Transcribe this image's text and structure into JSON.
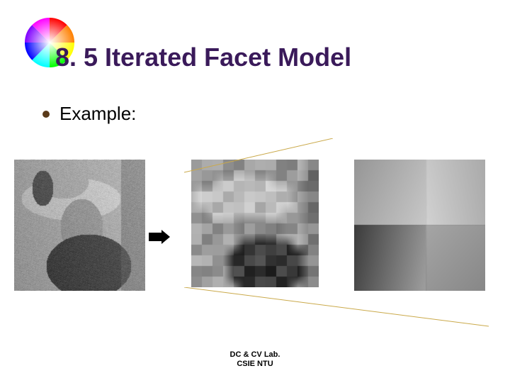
{
  "title": "8. 5 Iterated Facet Model",
  "bullet": "Example:",
  "footer_line1": "DC & CV Lab.",
  "footer_line2": "CSIE NTU",
  "icons": {
    "color_wheel": "color-wheel-icon",
    "arrow": "arrow-right-icon"
  }
}
